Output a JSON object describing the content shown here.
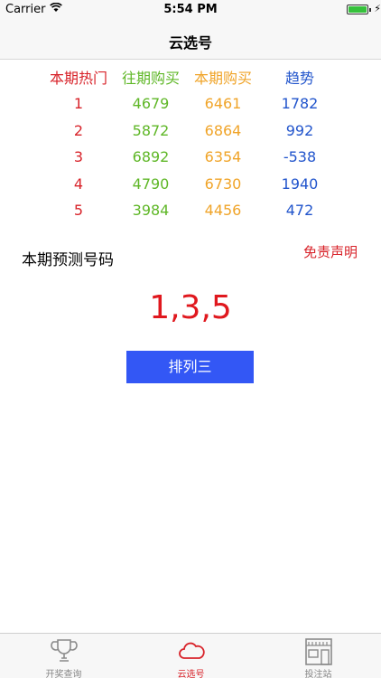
{
  "status_bar": {
    "carrier": "Carrier",
    "time": "5:54 PM"
  },
  "nav": {
    "title": "云选号"
  },
  "table": {
    "headers": [
      "本期热门",
      "往期购买",
      "本期购买",
      "趋势"
    ],
    "rows": [
      {
        "rank": "1",
        "past": "4679",
        "current": "6461",
        "trend": "1782"
      },
      {
        "rank": "2",
        "past": "5872",
        "current": "6864",
        "trend": "992"
      },
      {
        "rank": "3",
        "past": "6892",
        "current": "6354",
        "trend": "-538"
      },
      {
        "rank": "4",
        "past": "4790",
        "current": "6730",
        "trend": "1940"
      },
      {
        "rank": "5",
        "past": "3984",
        "current": "4456",
        "trend": "472"
      }
    ],
    "colors": {
      "rank": "#d8232a",
      "past": "#5fb727",
      "current": "#f0a429",
      "trend": "#2255cc"
    }
  },
  "prediction": {
    "label": "本期预测号码",
    "disclaimer": "免责声明",
    "numbers": "1,3,5",
    "button_label": "排列三"
  },
  "tab_bar": {
    "items": [
      {
        "label": "开奖查询",
        "icon": "trophy-icon",
        "active": false
      },
      {
        "label": "云选号",
        "icon": "cloud-icon",
        "active": true
      },
      {
        "label": "投注站",
        "icon": "store-icon",
        "active": false
      }
    ]
  }
}
